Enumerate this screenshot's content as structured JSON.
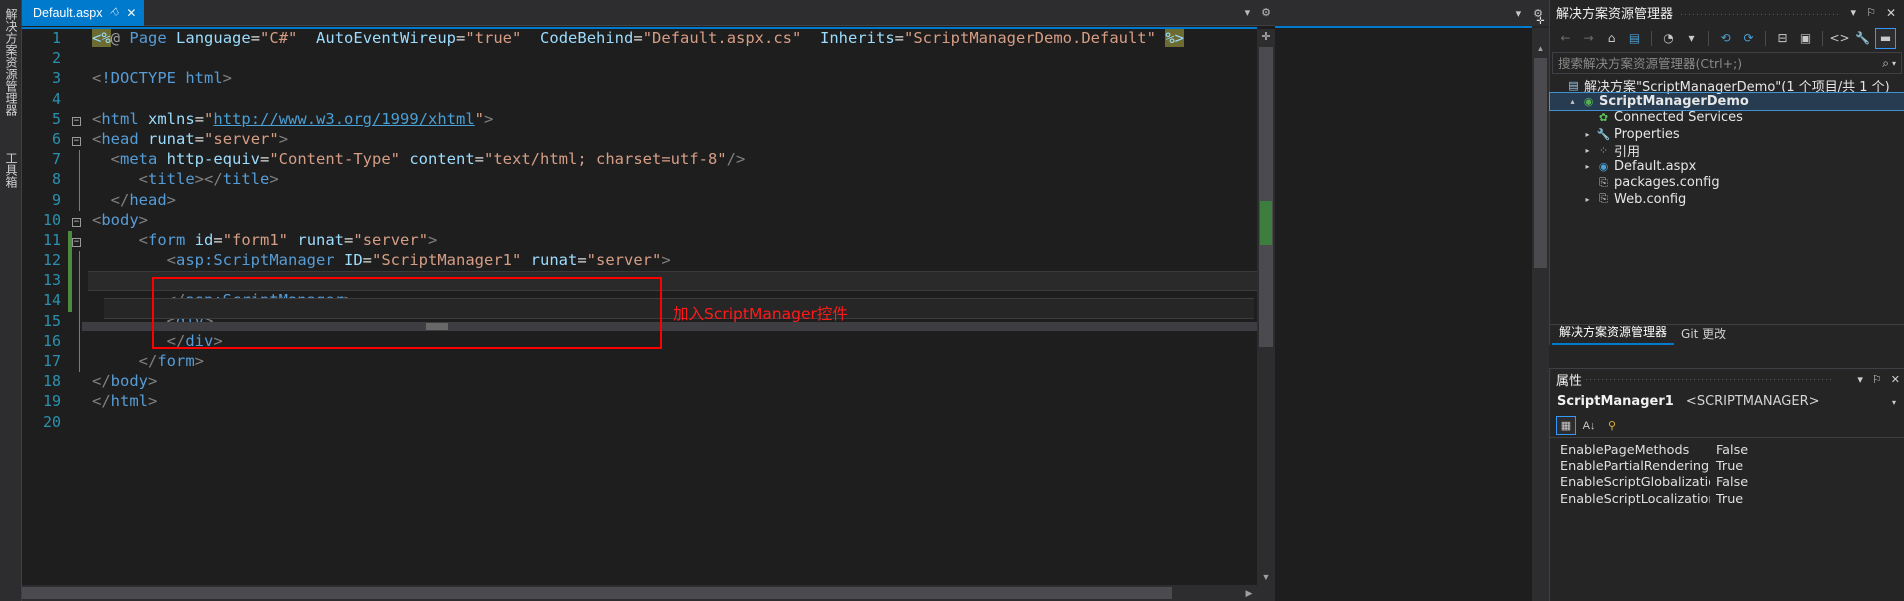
{
  "window": {
    "vertical_docks": [
      "解决方案资源管理器",
      "工具箱"
    ]
  },
  "editor": {
    "tab": {
      "title": "Default.aspx",
      "pin_icon": "pin-icon",
      "close_icon": "close-icon"
    },
    "tabstrip_controls": {
      "chevron": "▾",
      "gear": "⚙"
    },
    "annotation": {
      "text": "加入ScriptManager控件",
      "color": "#ff1a1a"
    },
    "lines": [
      {
        "n": "1",
        "fold": "",
        "bar": false,
        "change": false,
        "tokens": [
          {
            "t": "<%",
            "c": "t-mark"
          },
          {
            "t": "@",
            "c": "t-dir"
          },
          {
            "t": " ",
            "c": "t-plain"
          },
          {
            "t": "Page",
            "c": "t-tag"
          },
          {
            "t": " ",
            "c": "t-plain"
          },
          {
            "t": "Language",
            "c": "t-attr"
          },
          {
            "t": "=",
            "c": "t-plain"
          },
          {
            "t": "\"C#\"",
            "c": "t-str"
          },
          {
            "t": "  ",
            "c": "t-plain"
          },
          {
            "t": "AutoEventWireup",
            "c": "t-attr"
          },
          {
            "t": "=",
            "c": "t-plain"
          },
          {
            "t": "\"true\"",
            "c": "t-str"
          },
          {
            "t": "  ",
            "c": "t-plain"
          },
          {
            "t": "CodeBehind",
            "c": "t-attr"
          },
          {
            "t": "=",
            "c": "t-plain"
          },
          {
            "t": "\"Default.aspx.cs\"",
            "c": "t-str"
          },
          {
            "t": "  ",
            "c": "t-plain"
          },
          {
            "t": "Inherits",
            "c": "t-attr"
          },
          {
            "t": "=",
            "c": "t-plain"
          },
          {
            "t": "\"ScriptManagerDemo.Default\"",
            "c": "t-str"
          },
          {
            "t": " ",
            "c": "t-plain"
          },
          {
            "t": "%>",
            "c": "t-mark"
          }
        ]
      },
      {
        "n": "2",
        "fold": "",
        "bar": false,
        "change": false,
        "tokens": []
      },
      {
        "n": "3",
        "fold": "",
        "bar": false,
        "change": false,
        "tokens": [
          {
            "t": "<",
            "c": "t-brk"
          },
          {
            "t": "!DOCTYPE html",
            "c": "t-tag"
          },
          {
            "t": ">",
            "c": "t-brk"
          }
        ]
      },
      {
        "n": "4",
        "fold": "",
        "bar": false,
        "change": false,
        "tokens": []
      },
      {
        "n": "5",
        "fold": "minus",
        "bar": false,
        "change": false,
        "tokens": [
          {
            "t": "<",
            "c": "t-brk"
          },
          {
            "t": "html",
            "c": "t-tag"
          },
          {
            "t": " ",
            "c": "t-plain"
          },
          {
            "t": "xmlns",
            "c": "t-attr"
          },
          {
            "t": "=",
            "c": "t-plain"
          },
          {
            "t": "\"",
            "c": "t-str"
          },
          {
            "t": "http://www.w3.org/1999/xhtml",
            "c": "t-link"
          },
          {
            "t": "\"",
            "c": "t-str"
          },
          {
            "t": ">",
            "c": "t-brk"
          }
        ]
      },
      {
        "n": "6",
        "fold": "minus",
        "bar": true,
        "change": false,
        "tokens": [
          {
            "t": "<",
            "c": "t-brk"
          },
          {
            "t": "head",
            "c": "t-tag"
          },
          {
            "t": " ",
            "c": "t-plain"
          },
          {
            "t": "runat",
            "c": "t-attr"
          },
          {
            "t": "=",
            "c": "t-plain"
          },
          {
            "t": "\"server\"",
            "c": "t-str"
          },
          {
            "t": ">",
            "c": "t-brk"
          }
        ]
      },
      {
        "n": "7",
        "fold": "",
        "bar": true,
        "change": false,
        "tokens": [
          {
            "t": "  <",
            "c": "t-brk"
          },
          {
            "t": "meta",
            "c": "t-tag"
          },
          {
            "t": " ",
            "c": "t-plain"
          },
          {
            "t": "http-equiv",
            "c": "t-attr"
          },
          {
            "t": "=",
            "c": "t-plain"
          },
          {
            "t": "\"Content-Type\"",
            "c": "t-str"
          },
          {
            "t": " ",
            "c": "t-plain"
          },
          {
            "t": "content",
            "c": "t-attr"
          },
          {
            "t": "=",
            "c": "t-plain"
          },
          {
            "t": "\"text/html; charset=utf-8\"",
            "c": "t-str"
          },
          {
            "t": "/>",
            "c": "t-brk"
          }
        ]
      },
      {
        "n": "8",
        "fold": "",
        "bar": true,
        "change": false,
        "tokens": [
          {
            "t": "     <",
            "c": "t-brk"
          },
          {
            "t": "title",
            "c": "t-tag"
          },
          {
            "t": ">",
            "c": "t-brk"
          },
          {
            "t": "</",
            "c": "t-brk"
          },
          {
            "t": "title",
            "c": "t-tag"
          },
          {
            "t": ">",
            "c": "t-brk"
          }
        ]
      },
      {
        "n": "9",
        "fold": "",
        "bar": true,
        "change": false,
        "tokens": [
          {
            "t": "  </",
            "c": "t-brk"
          },
          {
            "t": "head",
            "c": "t-tag"
          },
          {
            "t": ">",
            "c": "t-brk"
          }
        ]
      },
      {
        "n": "10",
        "fold": "minus",
        "bar": false,
        "change": false,
        "tokens": [
          {
            "t": "<",
            "c": "t-brk"
          },
          {
            "t": "body",
            "c": "t-tag"
          },
          {
            "t": ">",
            "c": "t-brk"
          }
        ]
      },
      {
        "n": "11",
        "fold": "minus",
        "bar": true,
        "change": true,
        "tokens": [
          {
            "t": "     <",
            "c": "t-brk"
          },
          {
            "t": "form",
            "c": "t-tag"
          },
          {
            "t": " ",
            "c": "t-plain"
          },
          {
            "t": "id",
            "c": "t-attr"
          },
          {
            "t": "=",
            "c": "t-plain"
          },
          {
            "t": "\"form1\"",
            "c": "t-str"
          },
          {
            "t": " ",
            "c": "t-plain"
          },
          {
            "t": "runat",
            "c": "t-attr"
          },
          {
            "t": "=",
            "c": "t-plain"
          },
          {
            "t": "\"server\"",
            "c": "t-str"
          },
          {
            "t": ">",
            "c": "t-brk"
          }
        ]
      },
      {
        "n": "12",
        "fold": "",
        "bar": true,
        "change": true,
        "tokens": [
          {
            "t": "        <",
            "c": "t-brk"
          },
          {
            "t": "asp:ScriptManager",
            "c": "t-srv"
          },
          {
            "t": " ",
            "c": "t-plain"
          },
          {
            "t": "ID",
            "c": "t-attr"
          },
          {
            "t": "=",
            "c": "t-plain"
          },
          {
            "t": "\"ScriptManager1\"",
            "c": "t-str"
          },
          {
            "t": " ",
            "c": "t-plain"
          },
          {
            "t": "runat",
            "c": "t-attr"
          },
          {
            "t": "=",
            "c": "t-plain"
          },
          {
            "t": "\"server\"",
            "c": "t-str"
          },
          {
            "t": ">",
            "c": "t-brk"
          }
        ]
      },
      {
        "n": "13",
        "fold": "",
        "bar": true,
        "change": true,
        "current": true,
        "tokens": []
      },
      {
        "n": "14",
        "fold": "",
        "bar": true,
        "change": true,
        "tokens": [
          {
            "t": "        </",
            "c": "t-brk"
          },
          {
            "t": "asp:ScriptManager",
            "c": "t-srv"
          },
          {
            "t": ">",
            "c": "t-brk"
          }
        ]
      },
      {
        "n": "15",
        "fold": "",
        "bar": true,
        "change": false,
        "tokens": [
          {
            "t": "        <",
            "c": "t-brk"
          },
          {
            "t": "div",
            "c": "t-tag"
          },
          {
            "t": ">",
            "c": "t-brk"
          }
        ]
      },
      {
        "n": "16",
        "fold": "",
        "bar": true,
        "change": false,
        "tokens": [
          {
            "t": "        </",
            "c": "t-brk"
          },
          {
            "t": "div",
            "c": "t-tag"
          },
          {
            "t": ">",
            "c": "t-brk"
          }
        ]
      },
      {
        "n": "17",
        "fold": "",
        "bar": true,
        "change": false,
        "tokens": [
          {
            "t": "     </",
            "c": "t-brk"
          },
          {
            "t": "form",
            "c": "t-tag"
          },
          {
            "t": ">",
            "c": "t-brk"
          }
        ]
      },
      {
        "n": "18",
        "fold": "",
        "bar": false,
        "change": false,
        "tokens": [
          {
            "t": "</",
            "c": "t-brk"
          },
          {
            "t": "body",
            "c": "t-tag"
          },
          {
            "t": ">",
            "c": "t-brk"
          }
        ]
      },
      {
        "n": "19",
        "fold": "",
        "bar": false,
        "change": false,
        "tokens": [
          {
            "t": "</",
            "c": "t-brk"
          },
          {
            "t": "html",
            "c": "t-tag"
          },
          {
            "t": ">",
            "c": "t-brk"
          }
        ]
      },
      {
        "n": "20",
        "fold": "",
        "bar": false,
        "change": false,
        "tokens": []
      }
    ]
  },
  "solution_explorer": {
    "title": "解决方案资源管理器",
    "header_buttons": {
      "chevron": "▾",
      "pin": "⚐",
      "close": "✕"
    },
    "toolbar": [
      {
        "name": "back-icon",
        "glyph": "←",
        "state": "dim"
      },
      {
        "name": "forward-icon",
        "glyph": "→",
        "state": "dim"
      },
      {
        "name": "home-icon",
        "glyph": "⌂",
        "state": "normal"
      },
      {
        "name": "solution-home-icon",
        "glyph": "▤",
        "state": "blue"
      },
      {
        "name": "pending-changes-icon",
        "glyph": "◔",
        "state": "normal"
      },
      {
        "name": "chevron-down-icon",
        "glyph": "▾",
        "state": "normal"
      },
      {
        "name": "sync-icon",
        "glyph": "⟲",
        "state": "blue"
      },
      {
        "name": "refresh-icon",
        "glyph": "⟳",
        "state": "blue"
      },
      {
        "name": "collapse-all-icon",
        "glyph": "⊟",
        "state": "normal"
      },
      {
        "name": "show-all-files-icon",
        "glyph": "▣",
        "state": "normal"
      },
      {
        "name": "view-code-icon",
        "glyph": "<>",
        "state": "normal"
      },
      {
        "name": "properties-icon",
        "glyph": "🔧",
        "state": "normal"
      },
      {
        "name": "preview-pane-icon",
        "glyph": "▬",
        "state": "active"
      }
    ],
    "search_placeholder": "搜索解决方案资源管理器(Ctrl+;)",
    "search_value": "",
    "search_icon": "search-icon",
    "tree": [
      {
        "indent": 0,
        "expander": "",
        "icon": "sln-ico",
        "glyph": "▤",
        "label": "解决方案\"ScriptManagerDemo\"(1 个项目/共 1 个)",
        "bold": false,
        "selected": false
      },
      {
        "indent": 1,
        "expander": "▴",
        "icon": "proj-ico",
        "glyph": "◉",
        "label": "ScriptManagerDemo",
        "bold": true,
        "selected": true
      },
      {
        "indent": 2,
        "expander": "",
        "icon": "svc-ico",
        "glyph": "✿",
        "label": "Connected Services",
        "bold": false,
        "selected": false
      },
      {
        "indent": 2,
        "expander": "▸",
        "icon": "prop-ico",
        "glyph": "🔧",
        "label": "Properties",
        "bold": false,
        "selected": false
      },
      {
        "indent": 2,
        "expander": "▸",
        "icon": "ref-ico",
        "glyph": "⁘",
        "label": "引用",
        "bold": false,
        "selected": false
      },
      {
        "indent": 2,
        "expander": "▸",
        "icon": "aspx-ico",
        "glyph": "◉",
        "label": "Default.aspx",
        "bold": false,
        "selected": false
      },
      {
        "indent": 2,
        "expander": "",
        "icon": "cfg-ico",
        "glyph": "⎘",
        "label": "packages.config",
        "bold": false,
        "selected": false
      },
      {
        "indent": 2,
        "expander": "▸",
        "icon": "cfg-ico",
        "glyph": "⎘",
        "label": "Web.config",
        "bold": false,
        "selected": false
      }
    ],
    "bottom_tabs": [
      {
        "label": "解决方案资源管理器",
        "active": true
      },
      {
        "label": "Git 更改",
        "active": false
      }
    ]
  },
  "properties_panel": {
    "title": "属性",
    "header_buttons": {
      "chevron": "▾",
      "pin": "⚐",
      "close": "✕"
    },
    "object_name": "ScriptManager1",
    "object_type": "<SCRIPTMANAGER>",
    "object_chevron": "▾",
    "toolbar": [
      {
        "name": "categorized-icon",
        "glyph": "▦",
        "state": "on"
      },
      {
        "name": "alphabetical-icon",
        "glyph": "A↓",
        "state": "normal"
      },
      {
        "name": "properties-page-icon",
        "glyph": "⚲",
        "state": "yellow"
      }
    ],
    "rows": [
      {
        "key": "EnablePageMethods",
        "value": "False"
      },
      {
        "key": "EnablePartialRendering",
        "value": "True"
      },
      {
        "key": "EnableScriptGlobalization",
        "value": "False"
      },
      {
        "key": "EnableScriptLocalization",
        "value": "True"
      }
    ]
  }
}
